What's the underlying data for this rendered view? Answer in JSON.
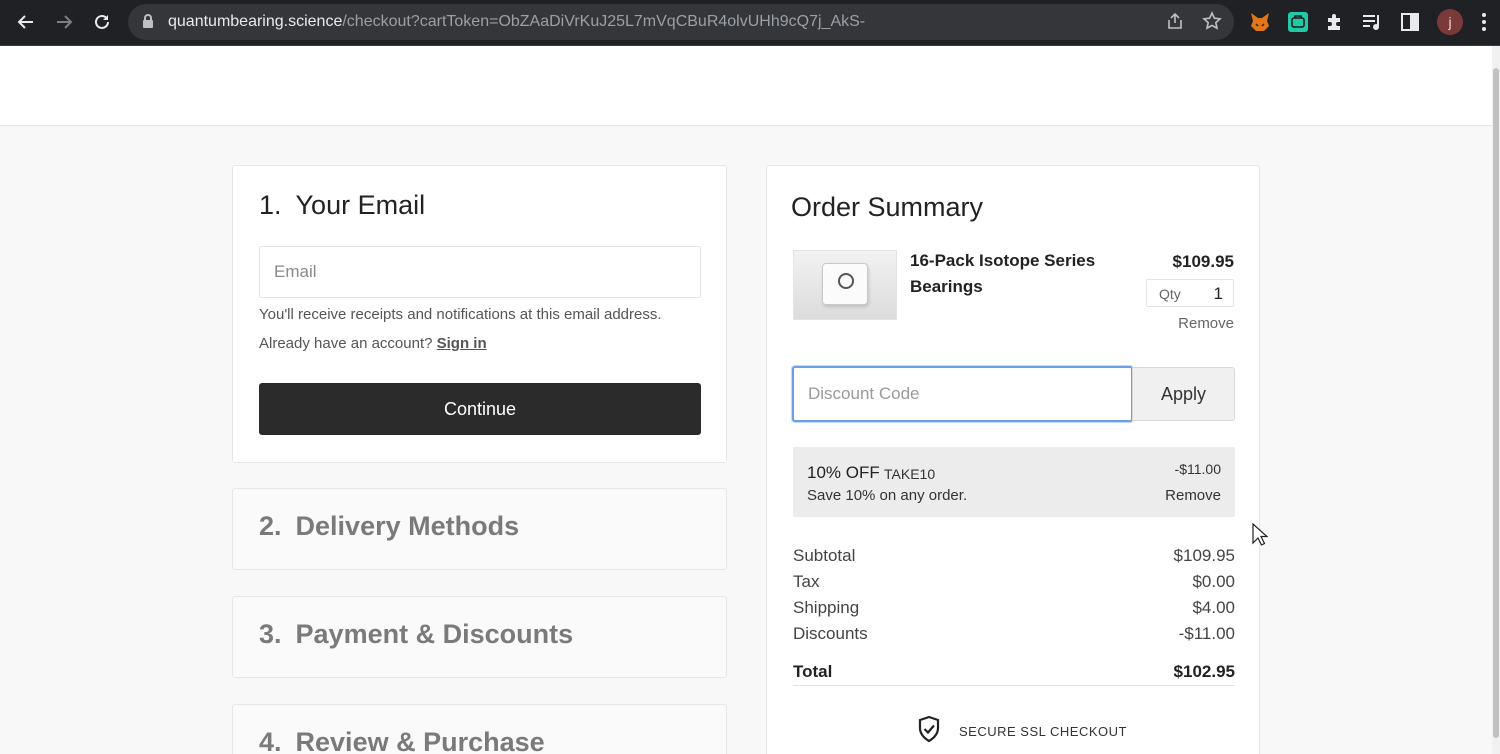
{
  "browser": {
    "url_host": "quantumbearing.science",
    "url_path": "/checkout?cartToken=ObZAaDiVrKuJ25L7mVqCBuR4olvUHh9cQ7j_AkS-",
    "profile_initial": "j"
  },
  "email_step": {
    "number": "1.",
    "title": "Your Email",
    "email_placeholder": "Email",
    "receipt_note": "You'll receive receipts and notifications at this email address.",
    "account_prompt": "Already have an account?",
    "sign_in_label": "Sign in",
    "continue_label": "Continue"
  },
  "collapsed_steps": [
    {
      "number": "2.",
      "title": "Delivery Methods"
    },
    {
      "number": "3.",
      "title": "Payment & Discounts"
    },
    {
      "number": "4.",
      "title": "Review & Purchase"
    }
  ],
  "order_summary": {
    "title": "Order Summary",
    "item": {
      "name": "16-Pack Isotope Series Bearings",
      "price": "$109.95",
      "qty_label": "Qty",
      "qty": "1",
      "remove_label": "Remove"
    },
    "discount": {
      "placeholder": "Discount Code",
      "apply_label": "Apply",
      "applied": {
        "off_label": "10% OFF",
        "code": "TAKE10",
        "description": "Save 10% on any order.",
        "amount": "-$11.00",
        "remove_label": "Remove"
      }
    },
    "totals": [
      {
        "label": "Subtotal",
        "value": "$109.95"
      },
      {
        "label": "Tax",
        "value": "$0.00"
      },
      {
        "label": "Shipping",
        "value": "$4.00"
      },
      {
        "label": "Discounts",
        "value": "-$11.00"
      }
    ],
    "total": {
      "label": "Total",
      "value": "$102.95"
    },
    "secure_label": "SECURE SSL CHECKOUT"
  },
  "colors": {
    "continue_button": "#2b2b2b",
    "focus_ring": "#6c9fe6",
    "page_background": "#f8f8f8"
  }
}
